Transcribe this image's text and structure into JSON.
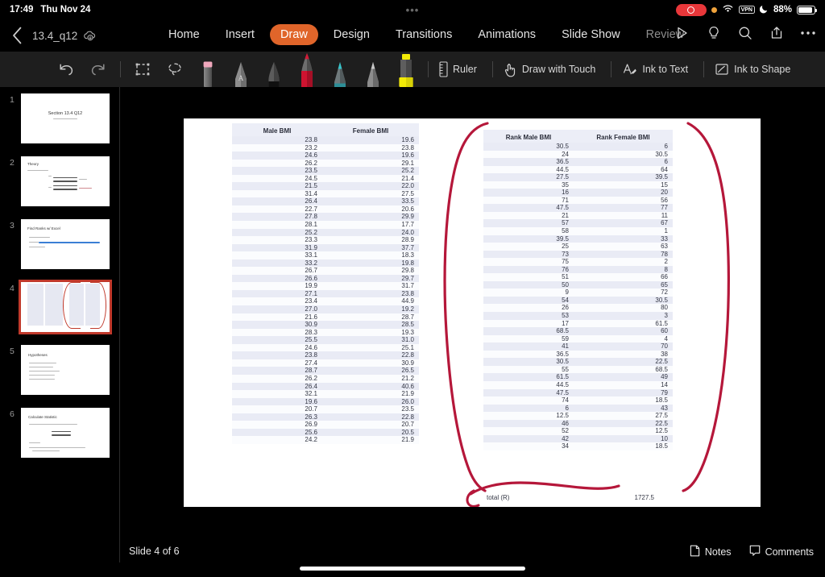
{
  "statusbar": {
    "time": "17:49",
    "date": "Thu Nov 24",
    "dots": "•••",
    "battery_pct": "88%",
    "vpn_label": "VPN",
    "icons": [
      "screen-recording-indicator",
      "orange-privacy-dot",
      "wifi-icon",
      "vpn-badge",
      "do-not-disturb-moon-icon",
      "battery-icon"
    ]
  },
  "titlebar": {
    "back_label": "‹",
    "doc_name": "13.4_q12",
    "cloud_status_icon": "cloud-upload-icon"
  },
  "ribbon": {
    "tabs": [
      {
        "label": "Home",
        "active": false
      },
      {
        "label": "Insert",
        "active": false
      },
      {
        "label": "Draw",
        "active": true
      },
      {
        "label": "Design",
        "active": false
      },
      {
        "label": "Transitions",
        "active": false
      },
      {
        "label": "Animations",
        "active": false
      },
      {
        "label": "Slide Show",
        "active": false
      },
      {
        "label": "Review",
        "active": false,
        "dim": true
      }
    ],
    "right_icons": [
      "play-icon",
      "lightbulb-icon",
      "search-icon",
      "share-icon",
      "more-ellipsis-icon"
    ],
    "accent_color": "#e0652a"
  },
  "drawtoolbar": {
    "undo_icon": "undo-icon",
    "redo_icon": "redo-icon",
    "select_icon": "rectangle-select-icon",
    "lasso_icon": "lasso-select-icon",
    "pens": [
      {
        "name": "eraser-tool",
        "color": "#f2a8bb",
        "selected": false
      },
      {
        "name": "pen-a-tool",
        "color": "#9a9a9a",
        "selected": false
      },
      {
        "name": "pen-black-tool",
        "color": "#121212",
        "selected": false
      },
      {
        "name": "pen-red-tool",
        "color": "#cf1330",
        "selected": true
      },
      {
        "name": "pencil-teal-tool",
        "color": "#35c3c9",
        "selected": false
      },
      {
        "name": "pencil-gray-tool",
        "color": "#c7c7c7",
        "selected": false
      },
      {
        "name": "highlighter-yellow-tool",
        "color": "#f2ea06",
        "selected": true
      }
    ],
    "ruler_label": "Ruler",
    "draw_with_touch_label": "Draw with Touch",
    "ink_to_text_label": "Ink to Text",
    "ink_to_shape_label": "Ink to Shape"
  },
  "thumbnails": [
    {
      "num": "1",
      "title": "Section 13.4 Q12",
      "selected": false
    },
    {
      "num": "2",
      "title": "Theory",
      "selected": false
    },
    {
      "num": "3",
      "title": "Find Ranks w/ Excel",
      "selected": false
    },
    {
      "num": "4",
      "title": "",
      "selected": true
    },
    {
      "num": "5",
      "title": "Hypotheses",
      "selected": false
    },
    {
      "num": "6",
      "title": "Calculate Statistic",
      "selected": false
    }
  ],
  "slide": {
    "left_table": {
      "headers": [
        "Male BMI",
        "Female BMI"
      ],
      "rows": [
        [
          "23.8",
          "19.6"
        ],
        [
          "23.2",
          "23.8"
        ],
        [
          "24.6",
          "19.6"
        ],
        [
          "26.2",
          "29.1"
        ],
        [
          "23.5",
          "25.2"
        ],
        [
          "24.5",
          "21.4"
        ],
        [
          "21.5",
          "22.0"
        ],
        [
          "31.4",
          "27.5"
        ],
        [
          "26.4",
          "33.5"
        ],
        [
          "22.7",
          "20.6"
        ],
        [
          "27.8",
          "29.9"
        ],
        [
          "28.1",
          "17.7"
        ],
        [
          "25.2",
          "24.0"
        ],
        [
          "23.3",
          "28.9"
        ],
        [
          "31.9",
          "37.7"
        ],
        [
          "33.1",
          "18.3"
        ],
        [
          "33.2",
          "19.8"
        ],
        [
          "26.7",
          "29.8"
        ],
        [
          "26.6",
          "29.7"
        ],
        [
          "19.9",
          "31.7"
        ],
        [
          "27.1",
          "23.8"
        ],
        [
          "23.4",
          "44.9"
        ],
        [
          "27.0",
          "19.2"
        ],
        [
          "21.6",
          "28.7"
        ],
        [
          "30.9",
          "28.5"
        ],
        [
          "28.3",
          "19.3"
        ],
        [
          "25.5",
          "31.0"
        ],
        [
          "24.6",
          "25.1"
        ],
        [
          "23.8",
          "22.8"
        ],
        [
          "27.4",
          "30.9"
        ],
        [
          "28.7",
          "26.5"
        ],
        [
          "26.2",
          "21.2"
        ],
        [
          "26.4",
          "40.6"
        ],
        [
          "32.1",
          "21.9"
        ],
        [
          "19.6",
          "26.0"
        ],
        [
          "20.7",
          "23.5"
        ],
        [
          "26.3",
          "22.8"
        ],
        [
          "26.9",
          "20.7"
        ],
        [
          "25.6",
          "20.5"
        ],
        [
          "24.2",
          "21.9"
        ]
      ]
    },
    "right_table": {
      "headers": [
        "Rank Male BMI",
        "Rank Female BMI"
      ],
      "rows": [
        [
          "30.5",
          "6"
        ],
        [
          "24",
          "30.5"
        ],
        [
          "36.5",
          "6"
        ],
        [
          "44.5",
          "64"
        ],
        [
          "27.5",
          "39.5"
        ],
        [
          "35",
          "15"
        ],
        [
          "16",
          "20"
        ],
        [
          "71",
          "56"
        ],
        [
          "47.5",
          "77"
        ],
        [
          "21",
          "11"
        ],
        [
          "57",
          "67"
        ],
        [
          "58",
          "1"
        ],
        [
          "39.5",
          "33"
        ],
        [
          "25",
          "63"
        ],
        [
          "73",
          "78"
        ],
        [
          "75",
          "2"
        ],
        [
          "76",
          "8"
        ],
        [
          "51",
          "66"
        ],
        [
          "50",
          "65"
        ],
        [
          "9",
          "72"
        ],
        [
          "54",
          "30.5"
        ],
        [
          "26",
          "80"
        ],
        [
          "53",
          "3"
        ],
        [
          "17",
          "61.5"
        ],
        [
          "68.5",
          "60"
        ],
        [
          "59",
          "4"
        ],
        [
          "41",
          "70"
        ],
        [
          "36.5",
          "38"
        ],
        [
          "30.5",
          "22.5"
        ],
        [
          "55",
          "68.5"
        ],
        [
          "61.5",
          "49"
        ],
        [
          "44.5",
          "14"
        ],
        [
          "47.5",
          "79"
        ],
        [
          "74",
          "18.5"
        ],
        [
          "6",
          "43"
        ],
        [
          "12.5",
          "27.5"
        ],
        [
          "46",
          "22.5"
        ],
        [
          "52",
          "12.5"
        ],
        [
          "42",
          "10"
        ],
        [
          "34",
          "18.5"
        ]
      ],
      "total_label": "total (R)",
      "total_value": "1727.5"
    },
    "ink_color": "#b5173a"
  },
  "bottombar": {
    "slide_count": "Slide 4 of 6",
    "notes_label": "Notes",
    "comments_label": "Comments",
    "notes_icon": "notes-icon",
    "comments_icon": "comment-bubble-icon"
  }
}
